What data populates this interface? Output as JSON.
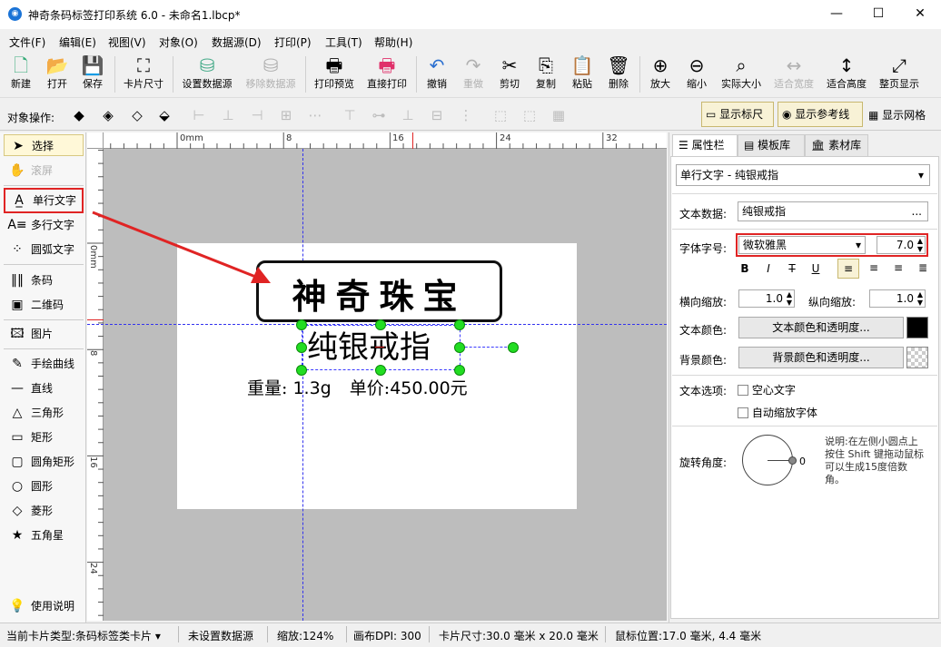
{
  "window": {
    "title": "神奇条码标签打印系统 6.0 - 未命名1.lbcp*",
    "controls": [
      "—",
      "☐",
      "✕"
    ]
  },
  "menu": [
    "文件(F)",
    "编辑(E)",
    "视图(V)",
    "对象(O)",
    "数据源(D)",
    "打印(P)",
    "工具(T)",
    "帮助(H)"
  ],
  "toolbar": {
    "new": "新建",
    "open": "打开",
    "save": "保存",
    "card_size": "卡片尺寸",
    "set_datasource": "设置数据源",
    "remove_datasource": "移除数据源",
    "print_preview": "打印预览",
    "direct_print": "直接打印",
    "undo": "撤销",
    "redo": "重做",
    "cut": "剪切",
    "copy": "复制",
    "paste": "粘贴",
    "delete": "删除",
    "zoom_in": "放大",
    "zoom_out": "缩小",
    "actual_size": "实际大小",
    "fit_width": "适合宽度",
    "fit_height": "适合高度",
    "full_page": "整页显示"
  },
  "objbar": {
    "label": "对象操作:",
    "show_ruler": "显示标尺",
    "show_guides": "显示参考线",
    "show_grid": "显示网格"
  },
  "tools": {
    "select": "选择",
    "scroll": "滚屏",
    "single_text": "单行文字",
    "multi_text": "多行文字",
    "arc_text": "圆弧文字",
    "barcode": "条码",
    "qrcode": "二维码",
    "image": "图片",
    "freehand": "手绘曲线",
    "line": "直线",
    "triangle": "三角形",
    "rectangle": "矩形",
    "round_rect": "圆角矩形",
    "circle": "圆形",
    "diamond": "菱形",
    "star": "五角星",
    "help": "使用说明"
  },
  "ruler": {
    "h_labels": [
      "0mm",
      "8",
      "16",
      "24",
      "32"
    ],
    "v_labels": [
      "0mm",
      "8",
      "16",
      "24"
    ]
  },
  "canvas": {
    "logo_text": "神奇珠宝",
    "selected_text": "纯银戒指",
    "weight_label": "重量:",
    "weight_value": "1.3g",
    "price_label": "单价:",
    "price_value": "450.00元"
  },
  "panel": {
    "tabs": [
      "属性栏",
      "模板库",
      "素材库"
    ],
    "object_select": "单行文字 - 纯银戒指",
    "text_data_label": "文本数据:",
    "text_data_value": "纯银戒指",
    "text_data_btn": "...",
    "font_label": "字体字号:",
    "font_name": "微软雅黑",
    "font_size": "7.0",
    "format_buttons": [
      "B",
      "I",
      "T",
      "U"
    ],
    "h_scale_label": "横向缩放:",
    "h_scale": "1.0",
    "v_scale_label": "纵向缩放:",
    "v_scale": "1.0",
    "text_color_label": "文本颜色:",
    "text_color_btn": "文本颜色和透明度...",
    "bg_color_label": "背景颜色:",
    "bg_color_btn": "背景颜色和透明度...",
    "text_options_label": "文本选项:",
    "hollow_text": "空心文字",
    "auto_shrink": "自动缩放字体",
    "rotation_label": "旋转角度:",
    "rotation_value": "0",
    "rotation_help": "说明:在左侧小圆点上按住 Shift 键拖动鼠标可以生成15度倍数角。"
  },
  "status": {
    "card_type": "当前卡片类型:条码标签类卡片",
    "datasource": "未设置数据源",
    "zoom": "缩放:124%",
    "dpi": "画布DPI: 300",
    "card_size": "卡片尺寸:30.0 毫米 x 20.0 毫米",
    "mouse_pos": "鼠标位置:17.0 毫米, 4.4 毫米"
  },
  "colors": {
    "accent": "#e02424",
    "handle": "#22dd22",
    "text_color": "#000000"
  }
}
